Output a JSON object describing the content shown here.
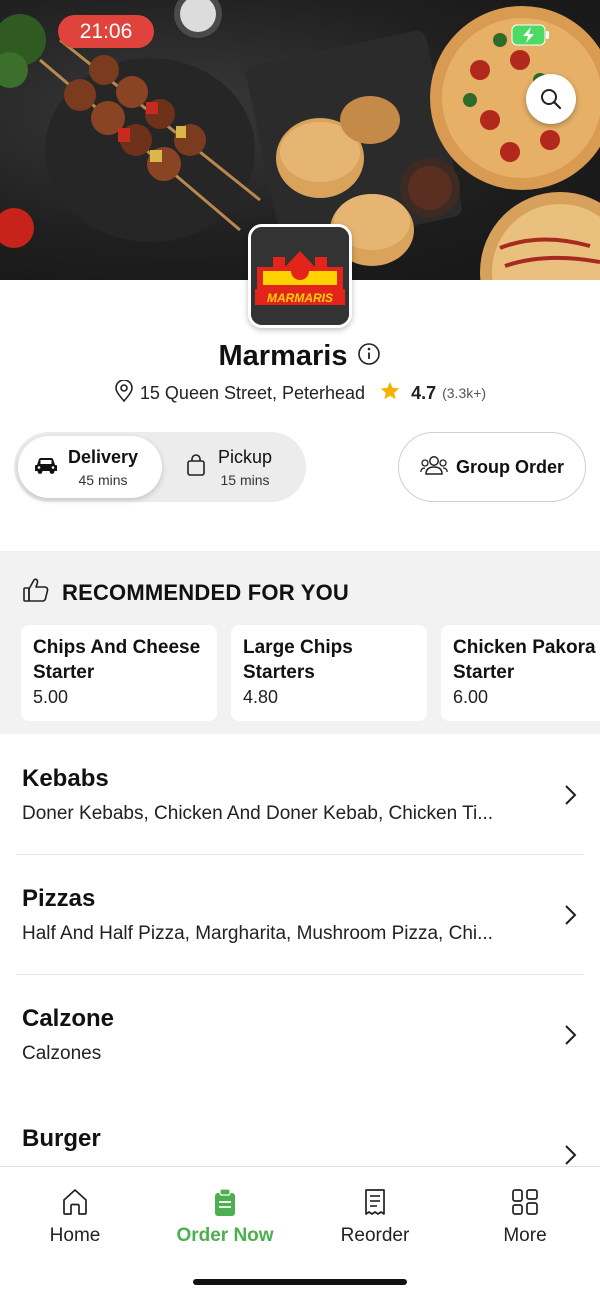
{
  "status_bar": {
    "time": "21:06"
  },
  "store": {
    "name": "Marmaris",
    "logo_text": "MARMARIS",
    "address": "15 Queen Street, Peterhead",
    "rating": "4.7",
    "rating_count": "(3.3k+)"
  },
  "order_type": {
    "delivery": {
      "label": "Delivery",
      "time": "45 mins",
      "selected": true
    },
    "pickup": {
      "label": "Pickup",
      "time": "15 mins",
      "selected": false
    },
    "group_order_label": "Group Order"
  },
  "recommended": {
    "title": "RECOMMENDED FOR YOU",
    "items": [
      {
        "name": "Chips And Cheese Starter",
        "price": "5.00"
      },
      {
        "name": "Large Chips Starters",
        "price": "4.80"
      },
      {
        "name": "Chicken Pakora Starter",
        "price": "6.00"
      }
    ]
  },
  "categories": [
    {
      "name": "Kebabs",
      "description": "Doner Kebabs, Chicken And Doner Kebab, Chicken Ti..."
    },
    {
      "name": "Pizzas",
      "description": "Half And Half Pizza, Margharita, Mushroom Pizza, Chi..."
    },
    {
      "name": "Calzone",
      "description": "Calzones"
    },
    {
      "name": "Burger",
      "description": ""
    }
  ],
  "bottom_nav": {
    "items": [
      {
        "label": "Home",
        "icon": "home-icon"
      },
      {
        "label": "Order Now",
        "icon": "order-icon"
      },
      {
        "label": "Reorder",
        "icon": "receipt-icon"
      },
      {
        "label": "More",
        "icon": "grid-icon"
      }
    ],
    "active": "Order Now"
  },
  "colors": {
    "accent_green": "#4caf50",
    "time_pill_red": "#e0433c",
    "star_gold": "#f5b301",
    "logo_red": "#e3241b",
    "logo_yellow": "#ffd200"
  }
}
